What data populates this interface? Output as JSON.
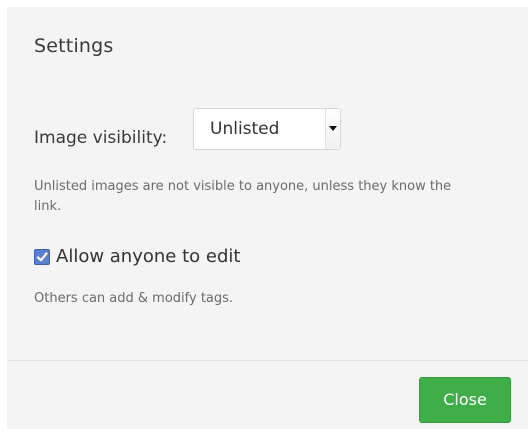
{
  "dialog": {
    "title": "Settings",
    "visibility": {
      "label": "Image visibility:",
      "selected": "Unlisted",
      "help": "Unlisted images are not visible to anyone, unless they know the link."
    },
    "edit": {
      "label": "Allow anyone to edit",
      "checked": true,
      "help": "Others can add & modify tags."
    },
    "close_label": "Close"
  },
  "colors": {
    "accent_green": "#3fae49",
    "checkbox_blue": "#5b7fcf",
    "panel_bg": "#f4f4f4"
  }
}
